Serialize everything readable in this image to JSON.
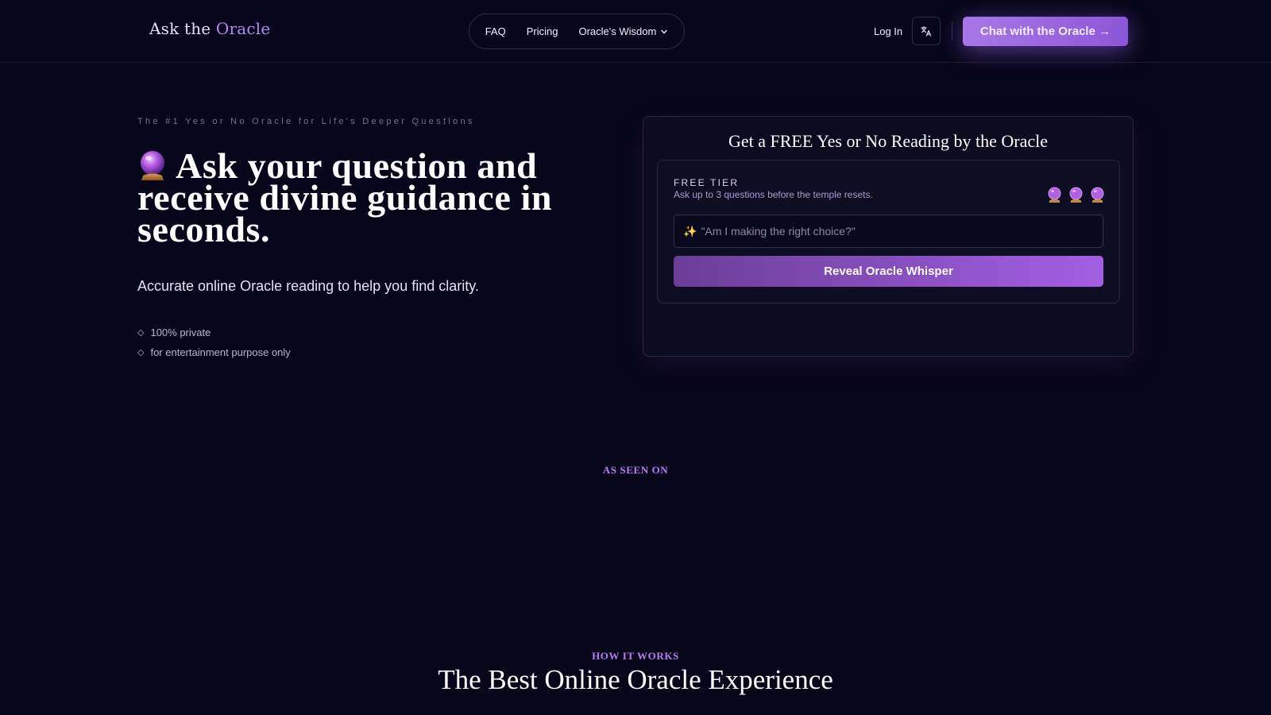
{
  "header": {
    "logo_prefix": "Ask the ",
    "logo_accent": "Oracle",
    "nav": {
      "faq": "FAQ",
      "pricing": "Pricing",
      "wisdom": "Oracle's Wisdom"
    },
    "login": "Log In",
    "lang_icon": "translate-icon",
    "cta": "Chat with the Oracle →"
  },
  "hero": {
    "eyebrow": "The #1 Yes or No Oracle for Life's Deeper Questions",
    "title_icon": "crystal-ball-icon",
    "title": "Ask your question and receive divine guidance in seconds.",
    "subtitle": "Accurate online Oracle reading to help you find clarity.",
    "bullets": [
      "100% private",
      "for entertainment purpose only"
    ]
  },
  "reading_card": {
    "title": "Get a FREE Yes or No Reading by the Oracle",
    "tier_label": "FREE TIER",
    "tier_desc": "Ask up to 3 questions before the temple resets.",
    "questions_remaining": 3,
    "input_placeholder": "\"Am I making the right choice?\"",
    "button": "Reveal Oracle Whisper"
  },
  "as_seen_on": "AS SEEN ON",
  "how_it_works": {
    "label": "HOW IT WORKS",
    "title": "The Best Online Oracle Experience"
  },
  "colors": {
    "background": "#07061a",
    "accent": "#a678e6",
    "accent_text": "#b67ef0"
  }
}
